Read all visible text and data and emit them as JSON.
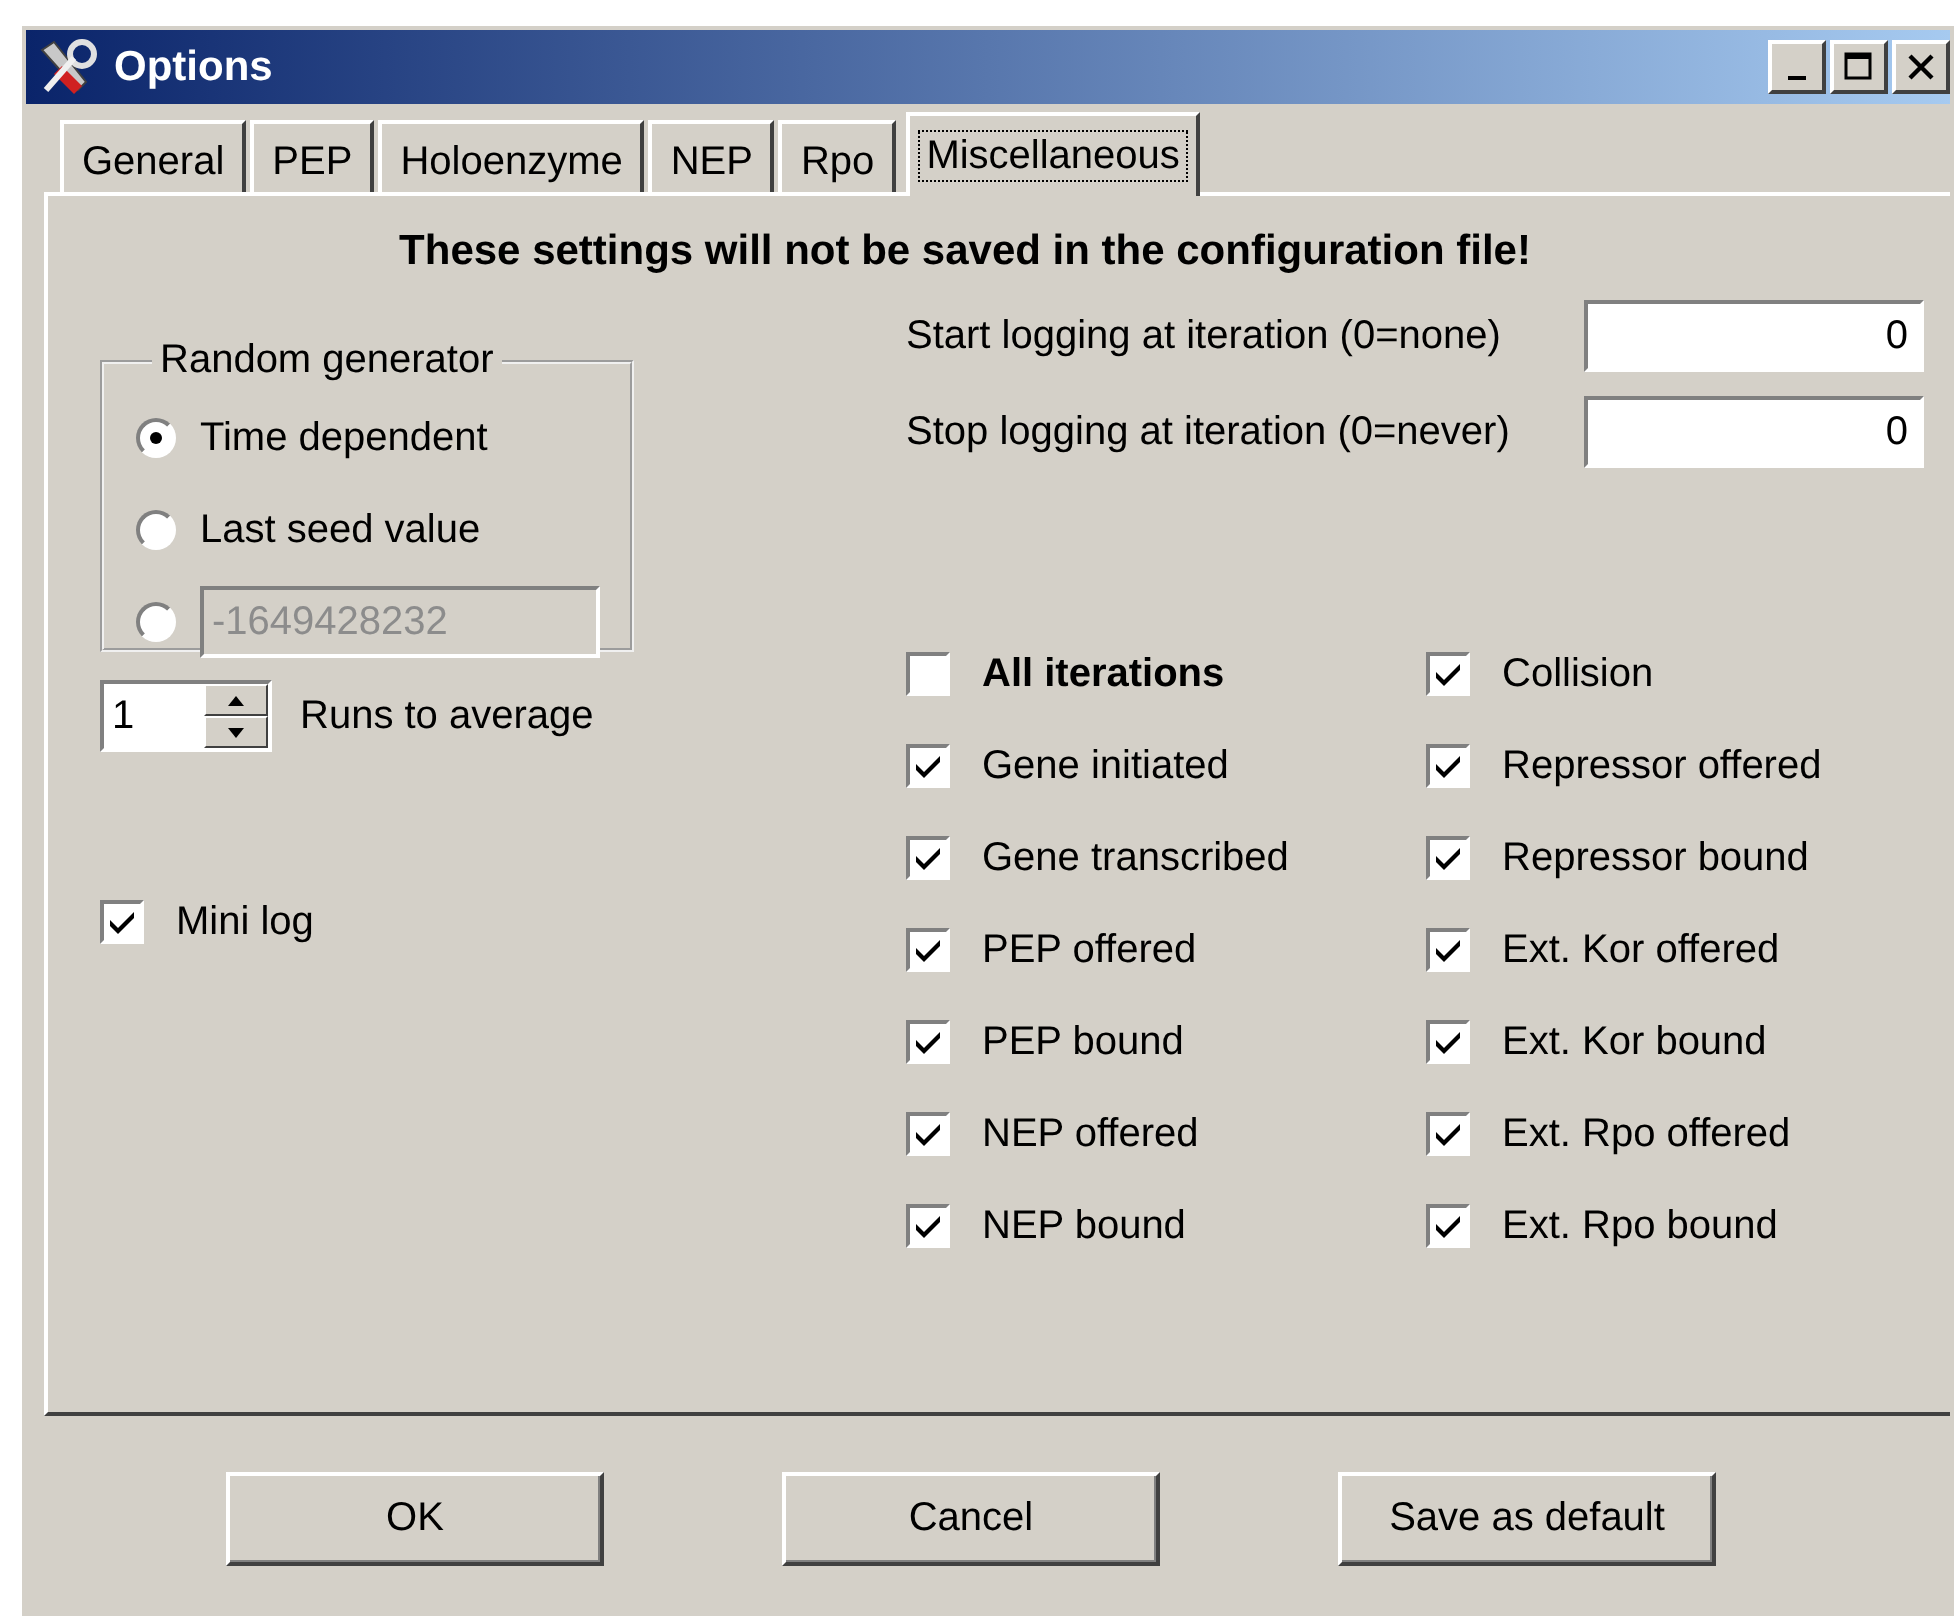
{
  "window": {
    "title": "Options"
  },
  "tabs": [
    {
      "label": "General",
      "selected": false
    },
    {
      "label": "PEP",
      "selected": false
    },
    {
      "label": "Holoenzyme",
      "selected": false
    },
    {
      "label": "NEP",
      "selected": false
    },
    {
      "label": "Rpo",
      "selected": false
    },
    {
      "label": "Miscellaneous",
      "selected": true
    }
  ],
  "notice": "These settings will not be saved in the configuration file!",
  "random_generator": {
    "title": "Random generator",
    "options": [
      {
        "kind": "label",
        "label": "Time dependent",
        "selected": true
      },
      {
        "kind": "label",
        "label": "Last seed value",
        "selected": false
      },
      {
        "kind": "field",
        "value": "-1649428232",
        "disabled": true,
        "selected": false
      }
    ]
  },
  "runs_to_average": {
    "value": "1",
    "label": "Runs to average"
  },
  "mini_log": {
    "label": "Mini log",
    "checked": true
  },
  "logging": [
    {
      "label": "Start logging at iteration (0=none)",
      "value": "0"
    },
    {
      "label": "Stop logging at iteration (0=never)",
      "value": "0"
    }
  ],
  "log_events": [
    [
      {
        "kind": "master",
        "label": "All iterations",
        "checked": false
      },
      {
        "kind": "event",
        "label": "Gene initiated",
        "checked": true
      },
      {
        "kind": "event",
        "label": "Gene transcribed",
        "checked": true
      },
      {
        "kind": "event",
        "label": "PEP offered",
        "checked": true
      },
      {
        "kind": "event",
        "label": "PEP bound",
        "checked": true
      },
      {
        "kind": "event",
        "label": "NEP offered",
        "checked": true
      },
      {
        "kind": "event",
        "label": "NEP bound",
        "checked": true
      }
    ],
    [
      {
        "kind": "event",
        "label": "Collision",
        "checked": true
      },
      {
        "kind": "event",
        "label": "Repressor offered",
        "checked": true
      },
      {
        "kind": "event",
        "label": "Repressor bound",
        "checked": true
      },
      {
        "kind": "event",
        "label": "Ext. Kor offered",
        "checked": true
      },
      {
        "kind": "event",
        "label": "Ext. Kor bound",
        "checked": true
      },
      {
        "kind": "event",
        "label": "Ext. Rpo offered",
        "checked": true
      },
      {
        "kind": "event",
        "label": "Ext. Rpo bound",
        "checked": true
      }
    ]
  ],
  "buttons": [
    "OK",
    "Cancel",
    "Save as default"
  ]
}
